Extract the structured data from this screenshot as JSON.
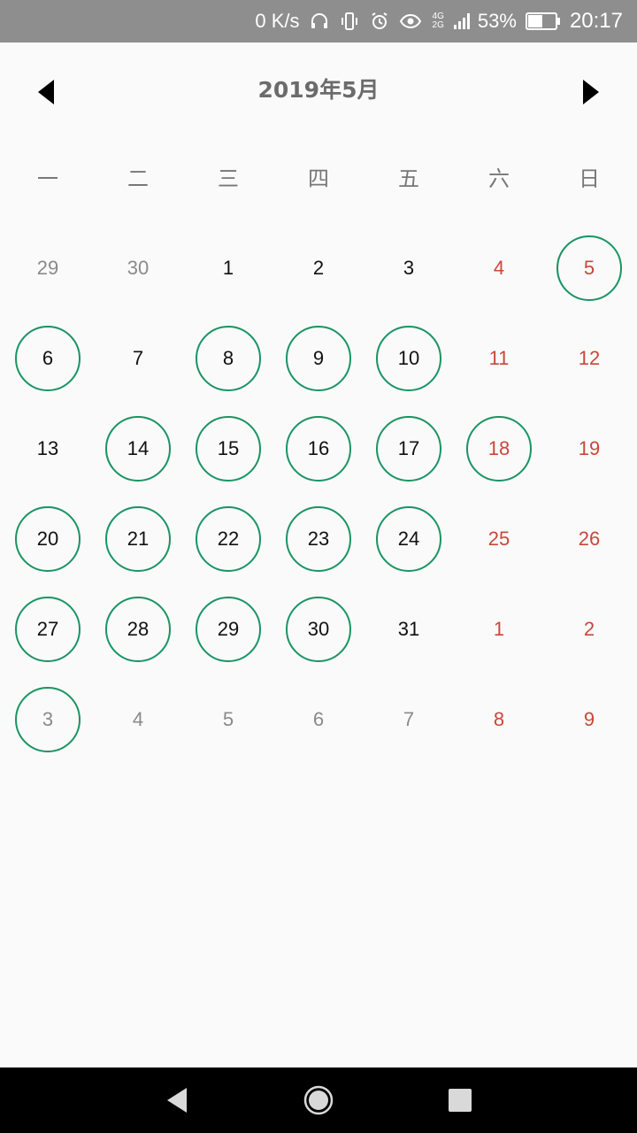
{
  "status_bar": {
    "speed": "0 K/s",
    "network": "4G",
    "network2": "2G",
    "battery_percent": "53%",
    "battery_level": 0.53,
    "time": "20:17",
    "icons": [
      "headphones-icon",
      "vibrate-icon",
      "alarm-icon",
      "eye-icon",
      "signal-icon",
      "battery-icon"
    ]
  },
  "header": {
    "title": "2019年5月",
    "prev_icon": "triangle-left-icon",
    "next_icon": "triangle-right-icon"
  },
  "weekdays": [
    "一",
    "二",
    "三",
    "四",
    "五",
    "六",
    "日"
  ],
  "colors": {
    "ring": "#1a9462",
    "weekend": "#c9473a",
    "current_month": "#111111",
    "other_month": "#8a8a8a"
  },
  "days": [
    {
      "label": "29",
      "month": "prev",
      "weekend": false,
      "marked": false
    },
    {
      "label": "30",
      "month": "prev",
      "weekend": false,
      "marked": false
    },
    {
      "label": "1",
      "month": "cur",
      "weekend": false,
      "marked": false
    },
    {
      "label": "2",
      "month": "cur",
      "weekend": false,
      "marked": false
    },
    {
      "label": "3",
      "month": "cur",
      "weekend": false,
      "marked": false
    },
    {
      "label": "4",
      "month": "cur",
      "weekend": true,
      "marked": false
    },
    {
      "label": "5",
      "month": "cur",
      "weekend": true,
      "marked": true
    },
    {
      "label": "6",
      "month": "cur",
      "weekend": false,
      "marked": true
    },
    {
      "label": "7",
      "month": "cur",
      "weekend": false,
      "marked": false
    },
    {
      "label": "8",
      "month": "cur",
      "weekend": false,
      "marked": true
    },
    {
      "label": "9",
      "month": "cur",
      "weekend": false,
      "marked": true
    },
    {
      "label": "10",
      "month": "cur",
      "weekend": false,
      "marked": true
    },
    {
      "label": "11",
      "month": "cur",
      "weekend": true,
      "marked": false
    },
    {
      "label": "12",
      "month": "cur",
      "weekend": true,
      "marked": false
    },
    {
      "label": "13",
      "month": "cur",
      "weekend": false,
      "marked": false
    },
    {
      "label": "14",
      "month": "cur",
      "weekend": false,
      "marked": true
    },
    {
      "label": "15",
      "month": "cur",
      "weekend": false,
      "marked": true
    },
    {
      "label": "16",
      "month": "cur",
      "weekend": false,
      "marked": true
    },
    {
      "label": "17",
      "month": "cur",
      "weekend": false,
      "marked": true
    },
    {
      "label": "18",
      "month": "cur",
      "weekend": true,
      "marked": true
    },
    {
      "label": "19",
      "month": "cur",
      "weekend": true,
      "marked": false
    },
    {
      "label": "20",
      "month": "cur",
      "weekend": false,
      "marked": true
    },
    {
      "label": "21",
      "month": "cur",
      "weekend": false,
      "marked": true
    },
    {
      "label": "22",
      "month": "cur",
      "weekend": false,
      "marked": true
    },
    {
      "label": "23",
      "month": "cur",
      "weekend": false,
      "marked": true
    },
    {
      "label": "24",
      "month": "cur",
      "weekend": false,
      "marked": true
    },
    {
      "label": "25",
      "month": "cur",
      "weekend": true,
      "marked": false
    },
    {
      "label": "26",
      "month": "cur",
      "weekend": true,
      "marked": false
    },
    {
      "label": "27",
      "month": "cur",
      "weekend": false,
      "marked": true
    },
    {
      "label": "28",
      "month": "cur",
      "weekend": false,
      "marked": true
    },
    {
      "label": "29",
      "month": "cur",
      "weekend": false,
      "marked": true
    },
    {
      "label": "30",
      "month": "cur",
      "weekend": false,
      "marked": true
    },
    {
      "label": "31",
      "month": "cur",
      "weekend": false,
      "marked": false
    },
    {
      "label": "1",
      "month": "next",
      "weekend": true,
      "marked": false
    },
    {
      "label": "2",
      "month": "next",
      "weekend": true,
      "marked": false
    },
    {
      "label": "3",
      "month": "next",
      "weekend": false,
      "marked": true
    },
    {
      "label": "4",
      "month": "next",
      "weekend": false,
      "marked": false
    },
    {
      "label": "5",
      "month": "next",
      "weekend": false,
      "marked": false
    },
    {
      "label": "6",
      "month": "next",
      "weekend": false,
      "marked": false
    },
    {
      "label": "7",
      "month": "next",
      "weekend": false,
      "marked": false
    },
    {
      "label": "8",
      "month": "next",
      "weekend": true,
      "marked": false
    },
    {
      "label": "9",
      "month": "next",
      "weekend": true,
      "marked": false
    }
  ],
  "nav_bar": {
    "icons": [
      "back-icon",
      "home-icon",
      "recents-icon"
    ]
  }
}
